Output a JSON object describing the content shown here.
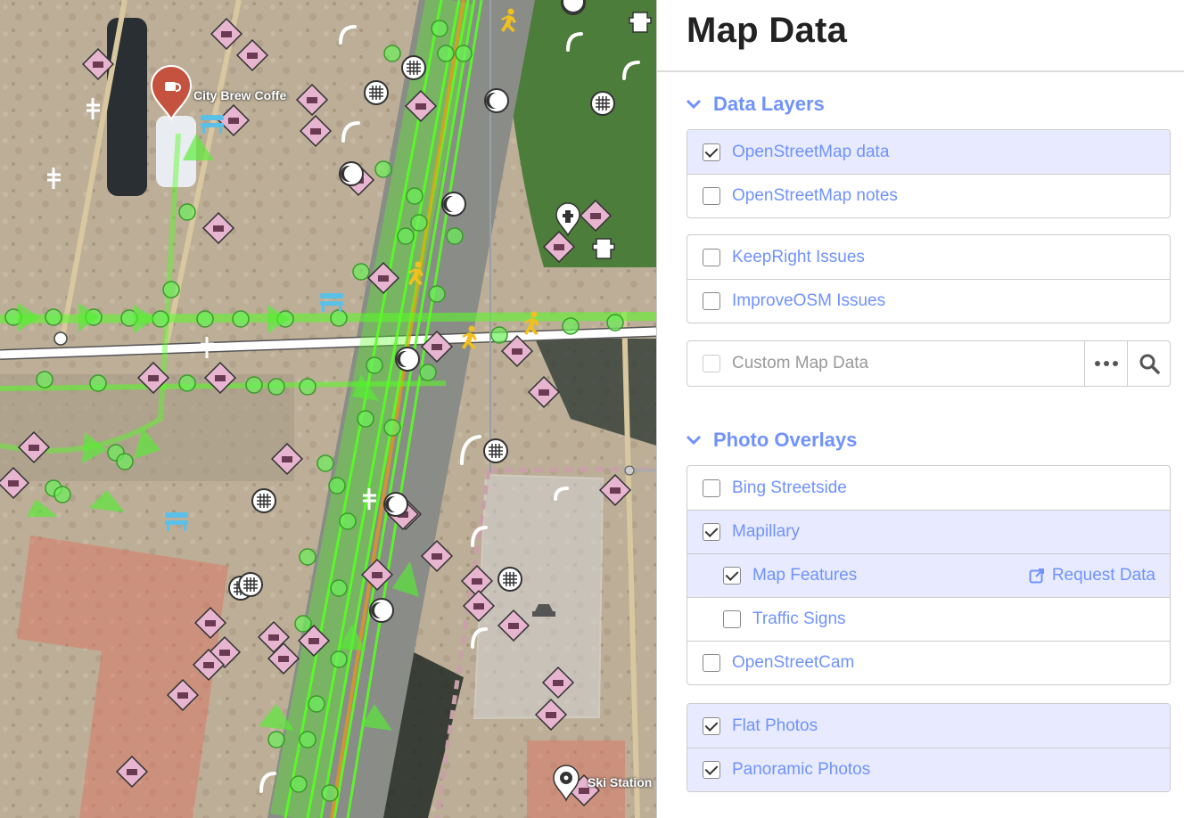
{
  "map": {
    "labels": {
      "city_brew": "City Brew Coffe",
      "ski_station": "Ski Station"
    }
  },
  "panel": {
    "title": "Map Data",
    "data_layers": {
      "title": "Data Layers",
      "items": [
        {
          "label": "OpenStreetMap data",
          "checked": true
        },
        {
          "label": "OpenStreetMap notes",
          "checked": false
        },
        {
          "label": "KeepRight Issues",
          "checked": false
        },
        {
          "label": "ImproveOSM Issues",
          "checked": false
        },
        {
          "label": "Custom Map Data",
          "checked": false
        }
      ]
    },
    "photo_overlays": {
      "title": "Photo Overlays",
      "items": [
        {
          "label": "Bing Streetside",
          "checked": false
        },
        {
          "label": "Mapillary",
          "checked": true
        },
        {
          "label": "Map Features",
          "checked": true
        },
        {
          "label": "Traffic Signs",
          "checked": false
        },
        {
          "label": "OpenStreetCam",
          "checked": false
        },
        {
          "label": "Flat Photos",
          "checked": true
        },
        {
          "label": "Panoramic Photos",
          "checked": true
        }
      ],
      "request_data_label": "Request Data"
    }
  },
  "colors": {
    "accent": "#7092ff",
    "active_row": "#e8ebff",
    "mapillary_track": "#35af6d",
    "sequence_green": "#55ff22",
    "building_fill": "#e06e5f"
  },
  "icons": [
    "chevron-down-icon",
    "ellipsis-icon",
    "search-icon",
    "external-link-icon",
    "coffee-pin-icon",
    "fire-hydrant-icon",
    "bench-icon",
    "pedestrian-icon",
    "streetlight-icon",
    "manhole-icon",
    "car-icon"
  ]
}
